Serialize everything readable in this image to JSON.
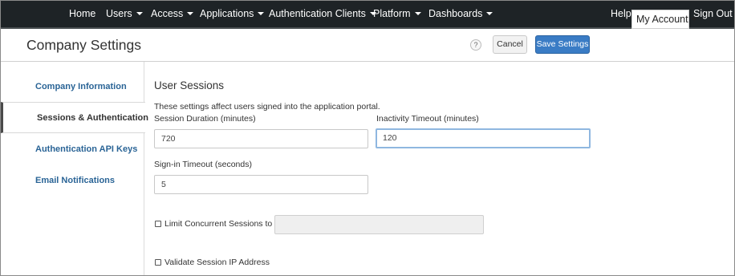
{
  "nav": {
    "items": [
      {
        "label": "Home",
        "dropdown": false
      },
      {
        "label": "Users",
        "dropdown": true
      },
      {
        "label": "Access",
        "dropdown": true
      },
      {
        "label": "Applications",
        "dropdown": true
      },
      {
        "label": "Authentication Clients",
        "dropdown": true
      },
      {
        "label": "Platform",
        "dropdown": true
      },
      {
        "label": "Dashboards",
        "dropdown": true
      }
    ],
    "help": "Help",
    "my_account": "My Account",
    "sign_out": "Sign Out"
  },
  "header": {
    "title": "Company Settings",
    "help_icon": "?",
    "cancel_label": "Cancel",
    "save_label": "Save Settings"
  },
  "sidebar": {
    "items": [
      {
        "label": "Company Information",
        "active": false
      },
      {
        "label": "Sessions & Authentication",
        "active": true
      },
      {
        "label": "Authentication API Keys",
        "active": false
      },
      {
        "label": "Email Notifications",
        "active": false
      }
    ]
  },
  "main": {
    "section_title": "User Sessions",
    "description": "These settings affect users signed into the application portal.",
    "session_duration": {
      "label": "Session Duration (minutes)",
      "value": "720"
    },
    "inactivity_timeout": {
      "label": "Inactivity Timeout (minutes)",
      "value": "120"
    },
    "signin_timeout": {
      "label": "Sign-in Timeout (seconds)",
      "value": "5"
    },
    "limit_concurrent": {
      "label": "Limit Concurrent Sessions to",
      "checked": false,
      "value": ""
    },
    "validate_ip": {
      "label": "Validate Session IP Address",
      "checked": false
    }
  },
  "colors": {
    "nav_bg": "#1e2326",
    "link": "#2a6496",
    "primary_button": "#3a7cc5",
    "focus_border": "#8fb7e0"
  }
}
